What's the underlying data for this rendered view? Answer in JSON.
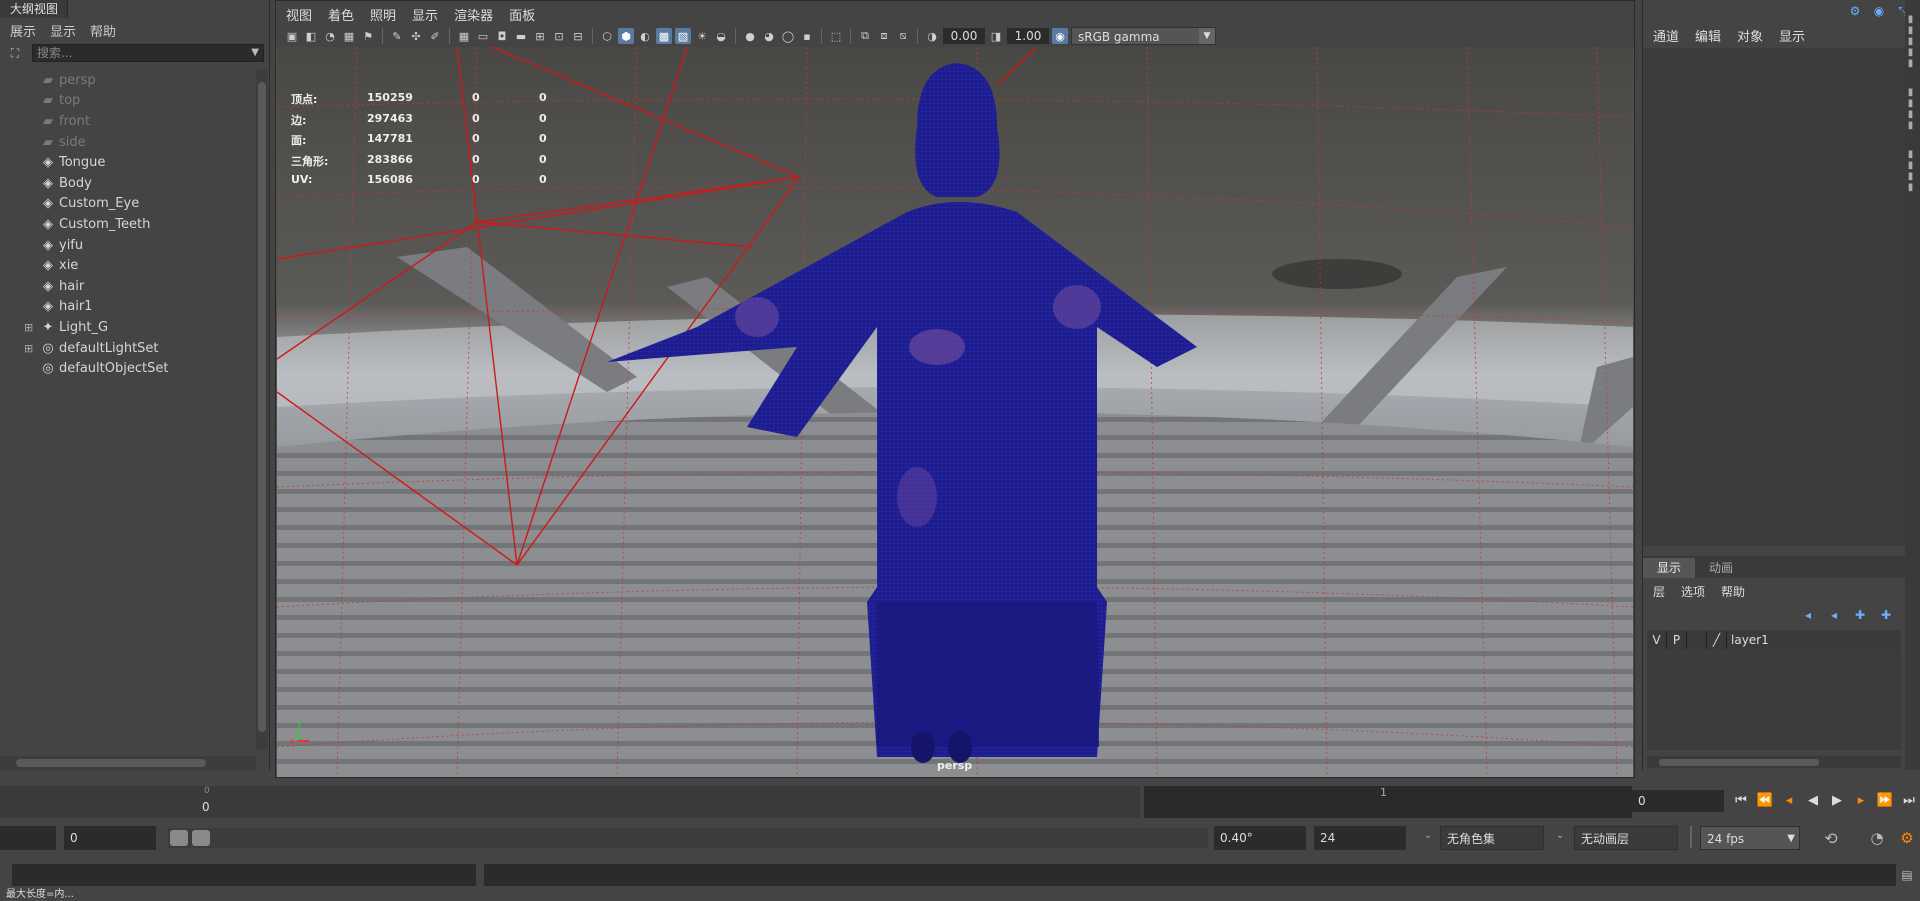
{
  "outliner": {
    "title": "大纲视图",
    "menu": [
      "展示",
      "显示",
      "帮助"
    ],
    "search_placeholder": "搜索...",
    "nodes": [
      {
        "label": "persp",
        "icon": "camera-icon",
        "dim": true
      },
      {
        "label": "top",
        "icon": "camera-icon",
        "dim": true
      },
      {
        "label": "front",
        "icon": "camera-icon",
        "dim": true
      },
      {
        "label": "side",
        "icon": "camera-icon",
        "dim": true
      },
      {
        "label": "Tongue",
        "icon": "mesh-icon",
        "dim": false
      },
      {
        "label": "Body",
        "icon": "mesh-icon",
        "dim": false
      },
      {
        "label": "Custom_Eye",
        "icon": "mesh-icon",
        "dim": false
      },
      {
        "label": "Custom_Teeth",
        "icon": "mesh-icon",
        "dim": false
      },
      {
        "label": "yifu",
        "icon": "mesh-icon",
        "dim": false
      },
      {
        "label": "xie",
        "icon": "mesh-icon",
        "dim": false
      },
      {
        "label": "hair",
        "icon": "mesh-icon",
        "dim": false
      },
      {
        "label": "hair1",
        "icon": "mesh-icon",
        "dim": false
      },
      {
        "label": "Light_G",
        "icon": "light-group-icon",
        "dim": false,
        "expandable": true
      },
      {
        "label": "defaultLightSet",
        "icon": "set-icon",
        "dim": false,
        "expandable": true
      },
      {
        "label": "defaultObjectSet",
        "icon": "set-icon",
        "dim": false
      }
    ]
  },
  "viewport": {
    "menu": [
      "视图",
      "着色",
      "照明",
      "显示",
      "渲染器",
      "面板"
    ],
    "exposure": "0.00",
    "gamma_value": "1.00",
    "color_space": "sRGB gamma",
    "camera_label": "persp",
    "hud": [
      {
        "key": "顶点:",
        "v1": "150259",
        "v2": "0",
        "v3": "0"
      },
      {
        "key": "边:",
        "v1": "297463",
        "v2": "0",
        "v3": "0"
      },
      {
        "key": "面:",
        "v1": "147781",
        "v2": "0",
        "v3": "0"
      },
      {
        "key": "三角形:",
        "v1": "283866",
        "v2": "0",
        "v3": "0"
      },
      {
        "key": "UV:",
        "v1": "156086",
        "v2": "0",
        "v3": "0"
      }
    ],
    "axis": {
      "x": "x",
      "y": "y"
    },
    "colors": {
      "wireframe": "#1a1a9a",
      "camera_frustum": "#d01818",
      "grid": "#c03030"
    }
  },
  "channel_box": {
    "menu": [
      "通道",
      "编辑",
      "对象",
      "显示"
    ]
  },
  "layer_editor": {
    "tabs": [
      "显示",
      "动画"
    ],
    "menu": [
      "层",
      "选项",
      "帮助"
    ],
    "layer": {
      "v": "V",
      "p": "P",
      "name": "layer1"
    }
  },
  "timeline": {
    "tick_start": "0",
    "tick_start_label": "0",
    "tick_one": "1",
    "current_frame": "0"
  },
  "range": {
    "start": "0",
    "angle": "0.40°",
    "end": "24",
    "char_set": "无角色集",
    "anim_layer": "无动画层",
    "fps": "24 fps"
  },
  "status_text": "最大长度=内..."
}
